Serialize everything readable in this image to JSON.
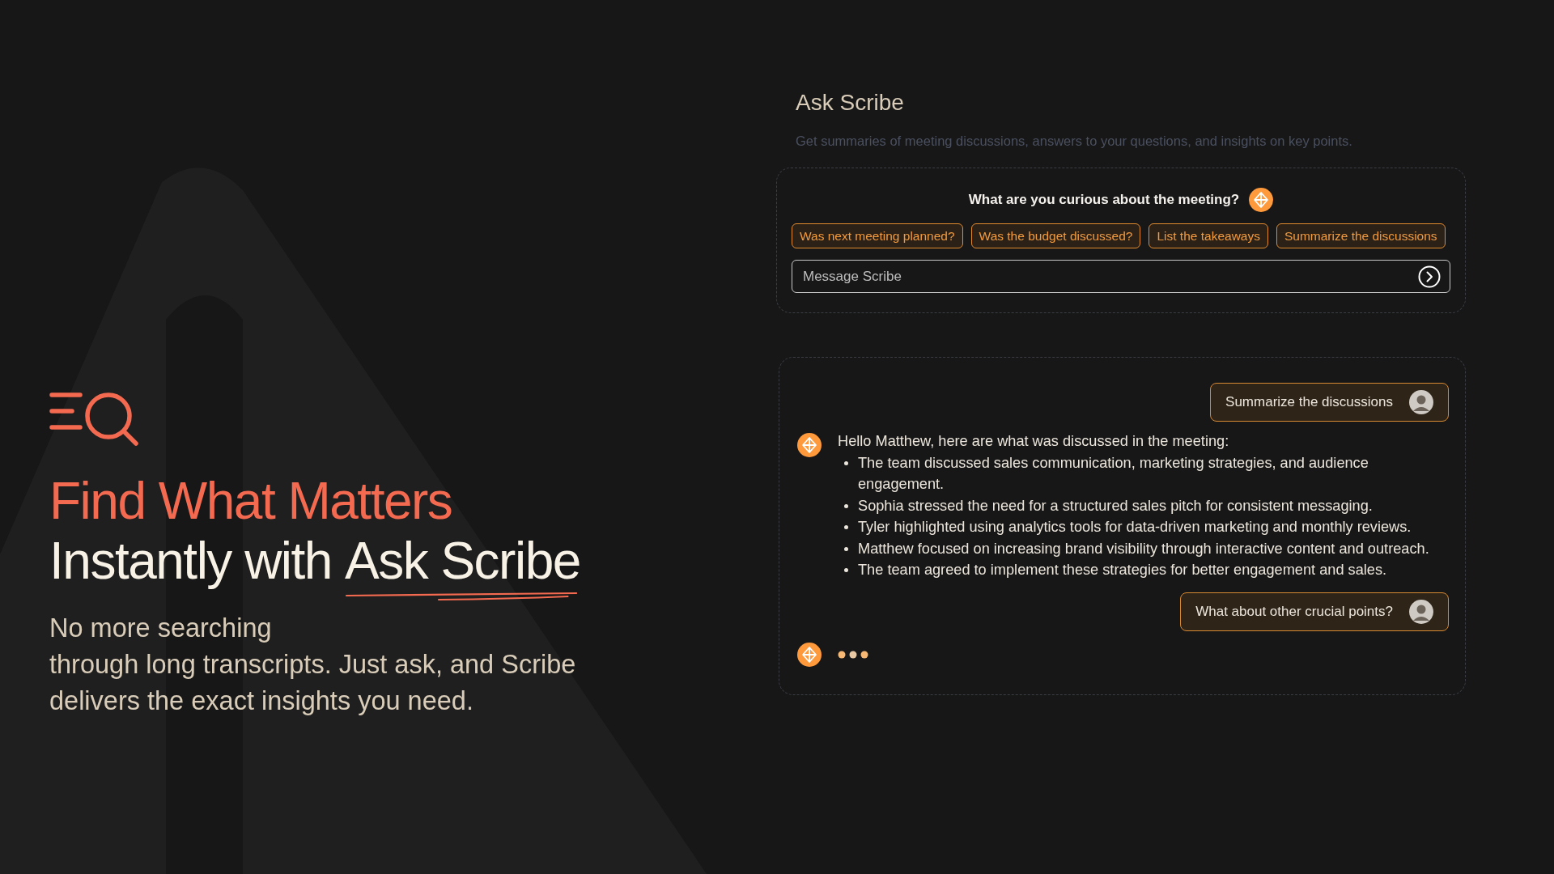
{
  "hero": {
    "headline_line_1": "Find What Matters",
    "headline_line_2": "Instantly with",
    "headline_highlight": "Ask Scribe",
    "description_lines": [
      "No more searching",
      "through long transcripts. Just ask, and Scribe",
      "delivers the exact insights you need."
    ]
  },
  "ask_panel": {
    "title": "Ask Scribe",
    "subtitle": "Get summaries of meeting discussions, answers to your questions, and insights on key points.",
    "prompt": "What are you curious about the meeting?",
    "suggestions": [
      "Was next meeting planned?",
      "Was the budget discussed?",
      "List the takeaways",
      "Summarize the discussions"
    ],
    "input": {
      "placeholder": "Message Scribe"
    }
  },
  "chat": {
    "messages": [
      {
        "kind": "user",
        "text": "Summarize the discussions"
      },
      {
        "kind": "bot",
        "intro": "Hello Matthew, here are what was discussed in the meeting:",
        "bullets": [
          "The team discussed sales communication, marketing strategies, and audience engagement.",
          "Sophia stressed the need for a structured sales pitch for consistent messaging.",
          "Tyler highlighted using analytics tools for data-driven marketing and monthly reviews.",
          "Matthew focused on increasing brand visibility through interactive content and outreach.",
          "The team agreed to implement these strategies for better engagement and sales."
        ]
      },
      {
        "kind": "user",
        "text": "What about other crucial points?"
      },
      {
        "kind": "typing"
      }
    ]
  }
}
